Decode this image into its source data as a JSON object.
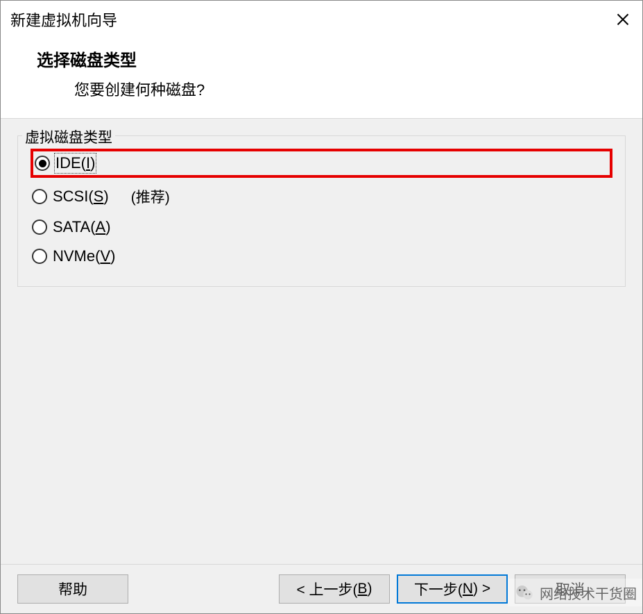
{
  "window": {
    "title": "新建虚拟机向导"
  },
  "header": {
    "heading": "选择磁盘类型",
    "subtext": "您要创建何种磁盘?"
  },
  "group": {
    "legend": "虚拟磁盘类型"
  },
  "options": {
    "ide": {
      "prefix": "IDE(",
      "mnemonic": "I",
      "suffix": ")"
    },
    "scsi": {
      "prefix": "SCSI(",
      "mnemonic": "S",
      "suffix": ")",
      "hint": "(推荐)"
    },
    "sata": {
      "prefix": "SATA(",
      "mnemonic": "A",
      "suffix": ")"
    },
    "nvme": {
      "prefix": "NVMe(",
      "mnemonic": "V",
      "suffix": ")"
    }
  },
  "buttons": {
    "help": "帮助",
    "back": {
      "lt": "< 上一步(",
      "mn": "B",
      "end": ")"
    },
    "next": {
      "pre": "下一步(",
      "mn": "N",
      "end": ") >"
    },
    "cancel": "取消"
  },
  "watermark": {
    "text": "网络技术干货圈"
  }
}
